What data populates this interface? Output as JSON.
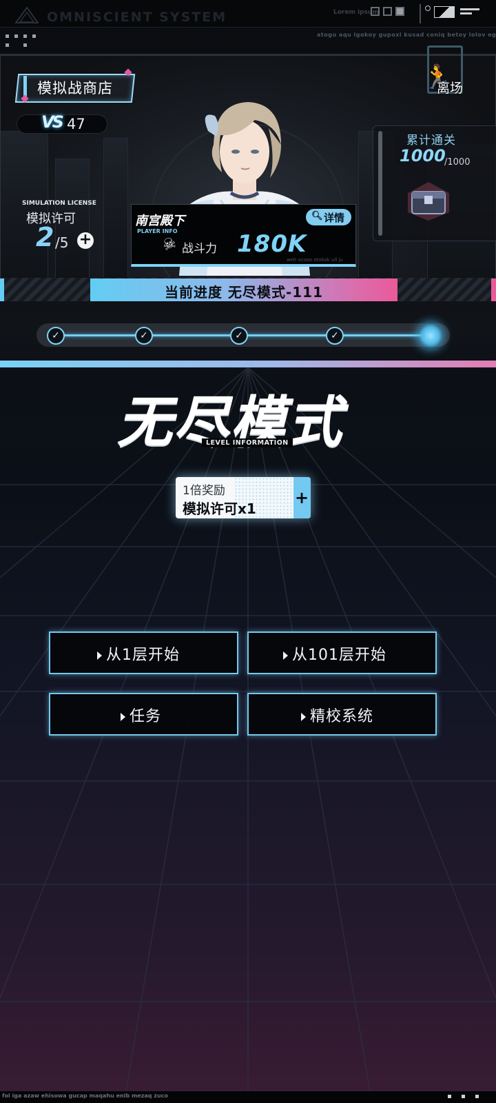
{
  "hud": {
    "system_title": "OMNISCIENT SYSTEM",
    "lorem": "Lorem ipsum",
    "tiny_text": "atogu aqu igokoy gupoxi kusad coniq betoy lolov ego oxx"
  },
  "shop": {
    "label": "模拟战商店"
  },
  "vs": {
    "icon_text": "VS",
    "value": "47"
  },
  "license": {
    "title_en": "SIMULATION LICENSE",
    "title_cn": "模拟许可",
    "current": "2",
    "total": "/5",
    "plus": "+"
  },
  "exit": {
    "label": "离场"
  },
  "cumulative_clear": {
    "title": "累计通关",
    "value": "1000",
    "max": "/1000"
  },
  "player": {
    "name": "南宫殿下",
    "info_en": "PLAYER INFO",
    "detail_label": "详情",
    "power_label": "战斗力",
    "power_value": "180K",
    "tiny_text": "weh ocoso otokok ull ju"
  },
  "progress": {
    "label": "当前进度 无尽模式-111",
    "stages_completed": 4,
    "stages_total": 5,
    "check": "✓"
  },
  "mode": {
    "title": "无尽模式",
    "subtitle": "LEVEL INFORMATION"
  },
  "reward": {
    "multiplier": "1倍奖励",
    "item": "模拟许可x1",
    "plus": "+"
  },
  "actions": {
    "start_1": "从1层开始",
    "start_101": "从101层开始",
    "tasks": "任务",
    "calibration": "精校系统"
  },
  "footer": {
    "text": "fol iga azaw ehisowa gucap maqahu enib mezaq zuco"
  },
  "colors": {
    "accent_blue": "#7fd3f7",
    "accent_pink": "#ea5a9a",
    "background": "#0b1018"
  },
  "icons": [
    "logo-icon",
    "vs-icon",
    "plus-icon",
    "exit-icon",
    "chest-icon",
    "search-icon",
    "gun-icon",
    "check-icon",
    "arrow-right-icon"
  ]
}
